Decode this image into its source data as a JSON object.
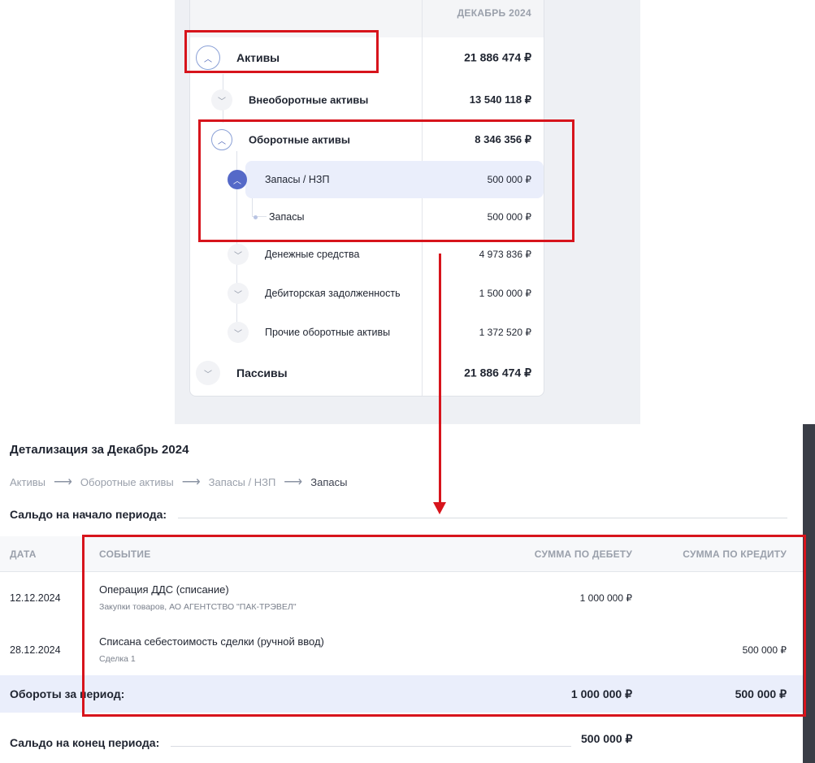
{
  "tree": {
    "period_header": "ДЕКАБРЬ 2024",
    "rows": [
      {
        "label": "Активы",
        "amount": "21 886 474 ₽"
      },
      {
        "label": "Внеоборотные активы",
        "amount": "13 540 118 ₽"
      },
      {
        "label": "Оборотные активы",
        "amount": "8 346 356 ₽"
      },
      {
        "label": "Запасы / НЗП",
        "amount": "500 000 ₽"
      },
      {
        "label": "Запасы",
        "amount": "500 000 ₽"
      },
      {
        "label": "Денежные средства",
        "amount": "4 973 836 ₽"
      },
      {
        "label": "Дебиторская задолженность",
        "amount": "1 500 000 ₽"
      },
      {
        "label": "Прочие оборотные активы",
        "amount": "1 372 520 ₽"
      },
      {
        "label": "Пассивы",
        "amount": "21 886 474 ₽"
      }
    ]
  },
  "detail": {
    "title": "Детализация за Декабрь 2024",
    "breadcrumb": [
      "Активы",
      "Оборотные активы",
      "Запасы / НЗП",
      "Запасы"
    ],
    "saldo_start_label": "Сальдо на начало периода:",
    "columns": {
      "date": "ДАТА",
      "event": "СОБЫТИЕ",
      "debit": "СУММА ПО ДЕБЕТУ",
      "credit": "СУММА ПО КРЕДИТУ"
    },
    "rows": [
      {
        "date": "12.12.2024",
        "event": "Операция ДДС (списание)",
        "sub": "Закупки товаров, АО АГЕНТСТВО \"ПАК-ТРЭВЕЛ\"",
        "debit": "1 000 000 ₽",
        "credit": ""
      },
      {
        "date": "28.12.2024",
        "event": "Списана себестоимость сделки (ручной ввод)",
        "sub": "Сделка 1",
        "debit": "",
        "credit": "500 000 ₽"
      }
    ],
    "totals": {
      "label": "Обороты за период:",
      "debit": "1 000 000 ₽",
      "credit": "500 000 ₽"
    },
    "saldo_end": {
      "label": "Сальдо на конец периода:",
      "value": "500 000 ₽"
    }
  },
  "colors": {
    "accent": "#5569c8",
    "annotation": "#d7141c",
    "selected_bg": "#eaeefb"
  },
  "icons": {
    "expand": "chevron-down-icon",
    "collapse": "chevron-up-icon",
    "arrow": "arrow-right-icon"
  }
}
